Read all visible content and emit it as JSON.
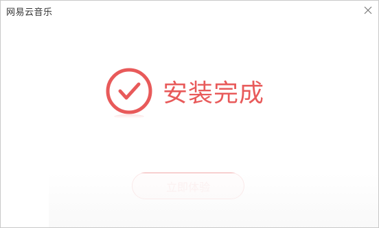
{
  "window": {
    "title": "网易云音乐"
  },
  "status": {
    "message": "安装完成"
  },
  "actions": {
    "start_label": "立即体验"
  },
  "icons": {
    "close": "close-icon",
    "success": "check-circle-icon"
  },
  "colors": {
    "accent": "#e85a5a",
    "button_border": "#f0a8a8"
  }
}
